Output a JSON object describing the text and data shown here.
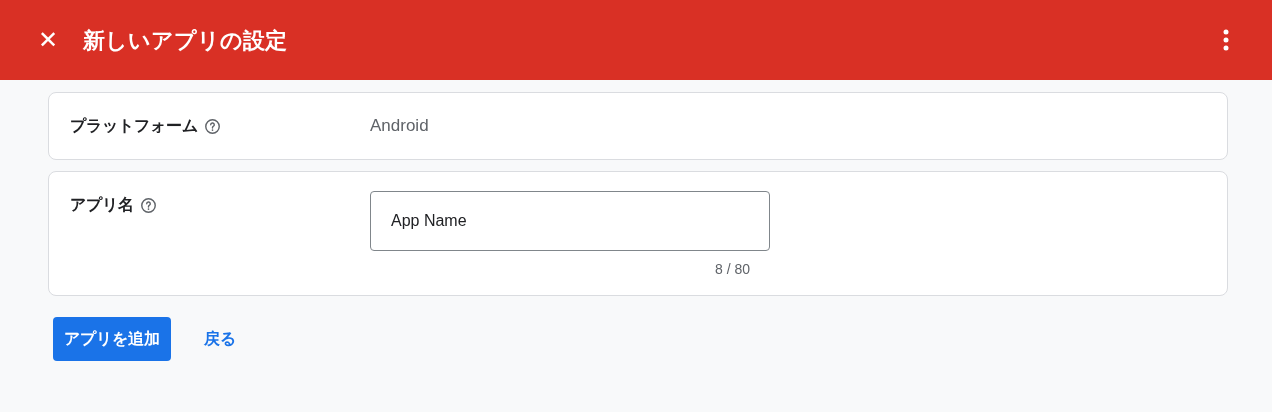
{
  "header": {
    "close": "✕",
    "title": "新しいアプリの設定"
  },
  "rows": [
    {
      "kind": "text",
      "label": "プラットフォーム",
      "value": "Android"
    },
    {
      "kind": "input",
      "label": "アプリ名",
      "value": "App Name",
      "counter": "8 / 80"
    }
  ],
  "buttons": [
    {
      "kind": "primary",
      "label": "アプリを追加"
    },
    {
      "kind": "text",
      "label": "戻る"
    }
  ]
}
